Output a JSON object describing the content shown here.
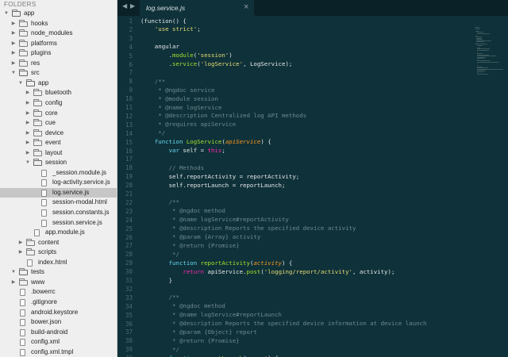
{
  "sidebar": {
    "header": "FOLDERS",
    "items": [
      {
        "label": "app",
        "depth": 0,
        "type": "folder",
        "open": true,
        "selected": false
      },
      {
        "label": "hooks",
        "depth": 1,
        "type": "folder",
        "open": false,
        "selected": false
      },
      {
        "label": "node_modules",
        "depth": 1,
        "type": "folder",
        "open": false,
        "selected": false
      },
      {
        "label": "platforms",
        "depth": 1,
        "type": "folder",
        "open": false,
        "selected": false
      },
      {
        "label": "plugins",
        "depth": 1,
        "type": "folder",
        "open": false,
        "selected": false
      },
      {
        "label": "res",
        "depth": 1,
        "type": "folder",
        "open": false,
        "selected": false
      },
      {
        "label": "src",
        "depth": 1,
        "type": "folder",
        "open": true,
        "selected": false
      },
      {
        "label": "app",
        "depth": 2,
        "type": "folder",
        "open": true,
        "selected": false
      },
      {
        "label": "bluetooth",
        "depth": 3,
        "type": "folder",
        "open": false,
        "selected": false
      },
      {
        "label": "config",
        "depth": 3,
        "type": "folder",
        "open": false,
        "selected": false
      },
      {
        "label": "core",
        "depth": 3,
        "type": "folder",
        "open": false,
        "selected": false
      },
      {
        "label": "cue",
        "depth": 3,
        "type": "folder",
        "open": false,
        "selected": false
      },
      {
        "label": "device",
        "depth": 3,
        "type": "folder",
        "open": false,
        "selected": false
      },
      {
        "label": "event",
        "depth": 3,
        "type": "folder",
        "open": false,
        "selected": false
      },
      {
        "label": "layout",
        "depth": 3,
        "type": "folder",
        "open": false,
        "selected": false
      },
      {
        "label": "session",
        "depth": 3,
        "type": "folder",
        "open": true,
        "selected": false
      },
      {
        "label": "_session.module.js",
        "depth": 4,
        "type": "file",
        "selected": false
      },
      {
        "label": "log-activity.service.js",
        "depth": 4,
        "type": "file",
        "selected": false
      },
      {
        "label": "log.service.js",
        "depth": 4,
        "type": "file",
        "selected": true
      },
      {
        "label": "session-modal.html",
        "depth": 4,
        "type": "file",
        "selected": false
      },
      {
        "label": "session.constants.js",
        "depth": 4,
        "type": "file",
        "selected": false
      },
      {
        "label": "session.service.js",
        "depth": 4,
        "type": "file",
        "selected": false
      },
      {
        "label": "app.module.js",
        "depth": 3,
        "type": "file",
        "selected": false
      },
      {
        "label": "content",
        "depth": 2,
        "type": "folder",
        "open": false,
        "selected": false
      },
      {
        "label": "scripts",
        "depth": 2,
        "type": "folder",
        "open": false,
        "selected": false
      },
      {
        "label": "index.html",
        "depth": 2,
        "type": "file",
        "selected": false
      },
      {
        "label": "tests",
        "depth": 1,
        "type": "folder",
        "open": true,
        "selected": false
      },
      {
        "label": "www",
        "depth": 1,
        "type": "folder",
        "open": false,
        "selected": false
      },
      {
        "label": ".bowerrc",
        "depth": 1,
        "type": "file",
        "selected": false
      },
      {
        "label": ".gitignore",
        "depth": 1,
        "type": "file",
        "selected": false
      },
      {
        "label": "android.keystore",
        "depth": 1,
        "type": "file",
        "selected": false
      },
      {
        "label": "bower.json",
        "depth": 1,
        "type": "file",
        "selected": false
      },
      {
        "label": "build-android",
        "depth": 1,
        "type": "file",
        "selected": false
      },
      {
        "label": "config.xml",
        "depth": 1,
        "type": "file",
        "selected": false
      },
      {
        "label": "config.xml.tmpl",
        "depth": 1,
        "type": "file",
        "selected": false
      }
    ]
  },
  "tabs": {
    "back_arrow": "◀",
    "forward_arrow": "▶",
    "active_tab": "log.service.js",
    "close_glyph": "×"
  },
  "editor": {
    "lines": [
      {
        "n": "1",
        "t": [
          [
            "p",
            "(function() {"
          ]
        ]
      },
      {
        "n": "2",
        "t": [
          [
            "p",
            "    "
          ],
          [
            "s",
            "'use strict'"
          ],
          [
            "p",
            ";"
          ]
        ]
      },
      {
        "n": "3",
        "t": []
      },
      {
        "n": "4",
        "t": [
          [
            "p",
            "    angular"
          ]
        ]
      },
      {
        "n": "5",
        "t": [
          [
            "p",
            "        ."
          ],
          [
            "f",
            "module"
          ],
          [
            "p",
            "("
          ],
          [
            "s",
            "'session'"
          ],
          [
            "p",
            ")"
          ]
        ]
      },
      {
        "n": "6",
        "t": [
          [
            "p",
            "        ."
          ],
          [
            "f",
            "service"
          ],
          [
            "p",
            "("
          ],
          [
            "s",
            "'logService'"
          ],
          [
            "p",
            ", LogService);"
          ]
        ]
      },
      {
        "n": "7",
        "t": []
      },
      {
        "n": "8",
        "t": [
          [
            "c",
            "    /**"
          ]
        ]
      },
      {
        "n": "9",
        "t": [
          [
            "c",
            "     * @ngdoc service"
          ]
        ]
      },
      {
        "n": "10",
        "t": [
          [
            "c",
            "     * @module session"
          ]
        ]
      },
      {
        "n": "11",
        "t": [
          [
            "c",
            "     * @name logService"
          ]
        ]
      },
      {
        "n": "12",
        "t": [
          [
            "c",
            "     * @description Centralized log API methods"
          ]
        ]
      },
      {
        "n": "13",
        "t": [
          [
            "c",
            "     * @requires apiService"
          ]
        ]
      },
      {
        "n": "14",
        "t": [
          [
            "c",
            "     */"
          ]
        ]
      },
      {
        "n": "15",
        "t": [
          [
            "v",
            "    function "
          ],
          [
            "f",
            "LogService"
          ],
          [
            "p",
            "("
          ],
          [
            "a",
            "apiService"
          ],
          [
            "p",
            ") {"
          ]
        ]
      },
      {
        "n": "16",
        "t": [
          [
            "v",
            "        var "
          ],
          [
            "p",
            "self = "
          ],
          [
            "k",
            "this"
          ],
          [
            "p",
            ";"
          ]
        ]
      },
      {
        "n": "17",
        "t": []
      },
      {
        "n": "18",
        "t": [
          [
            "c",
            "        // Methods"
          ]
        ]
      },
      {
        "n": "19",
        "t": [
          [
            "p",
            "        self.reportActivity = reportActivity;"
          ]
        ]
      },
      {
        "n": "20",
        "t": [
          [
            "p",
            "        self.reportLaunch = reportLaunch;"
          ]
        ]
      },
      {
        "n": "21",
        "t": []
      },
      {
        "n": "22",
        "t": [
          [
            "c",
            "        /**"
          ]
        ]
      },
      {
        "n": "23",
        "t": [
          [
            "c",
            "         * @ngdoc method"
          ]
        ]
      },
      {
        "n": "24",
        "t": [
          [
            "c",
            "         * @name logService#reportActivity"
          ]
        ]
      },
      {
        "n": "25",
        "t": [
          [
            "c",
            "         * @description Reports the specified device activity"
          ]
        ]
      },
      {
        "n": "26",
        "t": [
          [
            "c",
            "         * @param {Array} activity"
          ]
        ]
      },
      {
        "n": "27",
        "t": [
          [
            "c",
            "         * @return {Promise}"
          ]
        ]
      },
      {
        "n": "28",
        "t": [
          [
            "c",
            "         */"
          ]
        ]
      },
      {
        "n": "29",
        "t": [
          [
            "v",
            "        function "
          ],
          [
            "f",
            "reportActivity"
          ],
          [
            "p",
            "("
          ],
          [
            "a",
            "activity"
          ],
          [
            "p",
            ") {"
          ]
        ]
      },
      {
        "n": "30",
        "t": [
          [
            "k",
            "            return "
          ],
          [
            "p",
            "apiService."
          ],
          [
            "f",
            "post"
          ],
          [
            "p",
            "("
          ],
          [
            "s",
            "'logging/report/activity'"
          ],
          [
            "p",
            ", activity);"
          ]
        ]
      },
      {
        "n": "31",
        "t": [
          [
            "p",
            "        }"
          ]
        ]
      },
      {
        "n": "32",
        "t": []
      },
      {
        "n": "33",
        "t": [
          [
            "c",
            "        /**"
          ]
        ]
      },
      {
        "n": "34",
        "t": [
          [
            "c",
            "         * @ngdoc method"
          ]
        ]
      },
      {
        "n": "35",
        "t": [
          [
            "c",
            "         * @name logService#reportLaunch"
          ]
        ]
      },
      {
        "n": "36",
        "t": [
          [
            "c",
            "         * @description Reports the specified device information at device launch"
          ]
        ]
      },
      {
        "n": "37",
        "t": [
          [
            "c",
            "         * @param {Object} report"
          ]
        ]
      },
      {
        "n": "38",
        "t": [
          [
            "c",
            "         * @return {Promise}"
          ]
        ]
      },
      {
        "n": "39",
        "t": [
          [
            "c",
            "         */"
          ]
        ]
      },
      {
        "n": "40",
        "t": [
          [
            "v",
            "        function "
          ],
          [
            "f",
            "reportLaunch"
          ],
          [
            "p",
            "("
          ],
          [
            "a",
            "report"
          ],
          [
            "p",
            ") {"
          ]
        ]
      }
    ]
  },
  "colors": {
    "editor_bg": "#0f3139",
    "sidebar_bg": "#efefef",
    "selected_row": "#c6c6c6",
    "keyword": "#f92aad",
    "string": "#e6db74",
    "function": "#a6e22e",
    "comment": "#6e8a90"
  }
}
